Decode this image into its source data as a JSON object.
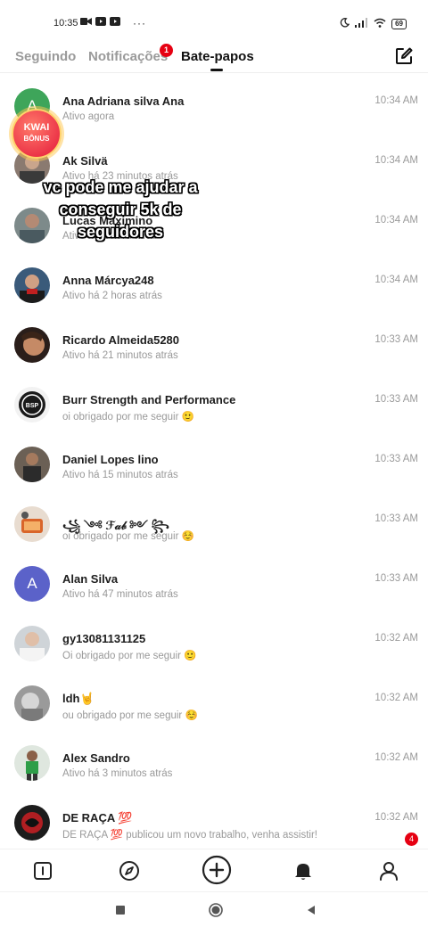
{
  "status_bar": {
    "time": "10:35",
    "battery": "69",
    "icons_left": [
      "video-call-icon",
      "youtube-icon",
      "youtube-icon",
      "more-dots-icon"
    ],
    "icons_right": [
      "moon-icon",
      "signal-icon",
      "wifi-icon",
      "battery-icon"
    ]
  },
  "header": {
    "tabs": [
      {
        "label": "Seguindo",
        "active": false
      },
      {
        "label": "Notificações",
        "active": false
      },
      {
        "label": "Bate-papos",
        "active": true
      }
    ],
    "notif_badge": "1",
    "compose_icon": "compose-icon"
  },
  "overlay": {
    "kwai_bonus_line1": "KWAI",
    "kwai_bonus_line2": "BÔNUS",
    "caption_line1": "vc pode me ajudar a",
    "caption_line2": "conseguir 5k de",
    "caption_line3": "seguidores"
  },
  "chats": [
    {
      "name": "Ana Adriana silva Ana",
      "status": "Ativo agora",
      "time": "10:34 AM"
    },
    {
      "name": "Ak Silvä",
      "status": "Ativo há 23 minutos atrás",
      "time": "10:34 AM"
    },
    {
      "name": "Lucas Maximino",
      "status": "Ativo há 1 hora atrás",
      "time": "10:34 AM"
    },
    {
      "name": "Anna Márcya248",
      "status": "Ativo há 2 horas atrás",
      "time": "10:34 AM"
    },
    {
      "name": "Ricardo Almeida5280",
      "status": "Ativo há 21 minutos atrás",
      "time": "10:33 AM"
    },
    {
      "name": "Burr Strength and Performance",
      "status": "oi obrigado por me seguir 🙂",
      "time": "10:33 AM"
    },
    {
      "name": "Daniel Lopes lino",
      "status": "Ativo há 15 minutos atrás",
      "time": "10:33 AM"
    },
    {
      "name": "꧁ ༺ ℱ𝒶𝒷 ༻ ꧂",
      "status": "oi obrigado por me seguir ☺️",
      "time": "10:33 AM"
    },
    {
      "name": "Alan Silva",
      "status": "Ativo há 47 minutos atrás",
      "time": "10:33 AM",
      "avatar_letter": "A"
    },
    {
      "name": "gy13081131125",
      "status": "Oi obrigado por me seguir 🙂",
      "time": "10:32 AM"
    },
    {
      "name": "ldh🤘",
      "status": "ou obrigado por me seguir ☺️",
      "time": "10:32 AM"
    },
    {
      "name": "Alex Sandro",
      "status": "Ativo há 3 minutos atrás",
      "time": "10:32 AM"
    },
    {
      "name": "DE RAÇA 💯",
      "status": "DE RAÇA 💯 publicou um novo trabalho, venha assistir!",
      "time": "10:32 AM",
      "unread": "4"
    }
  ],
  "avatar_first_letter": "A",
  "bottom_nav": [
    "home-icon",
    "discover-icon",
    "create-icon",
    "inbox-icon",
    "profile-icon"
  ],
  "colors": {
    "accent_red": "#e60012",
    "avatar_purple": "#5b62c9",
    "avatar_green": "#3ea55a"
  }
}
